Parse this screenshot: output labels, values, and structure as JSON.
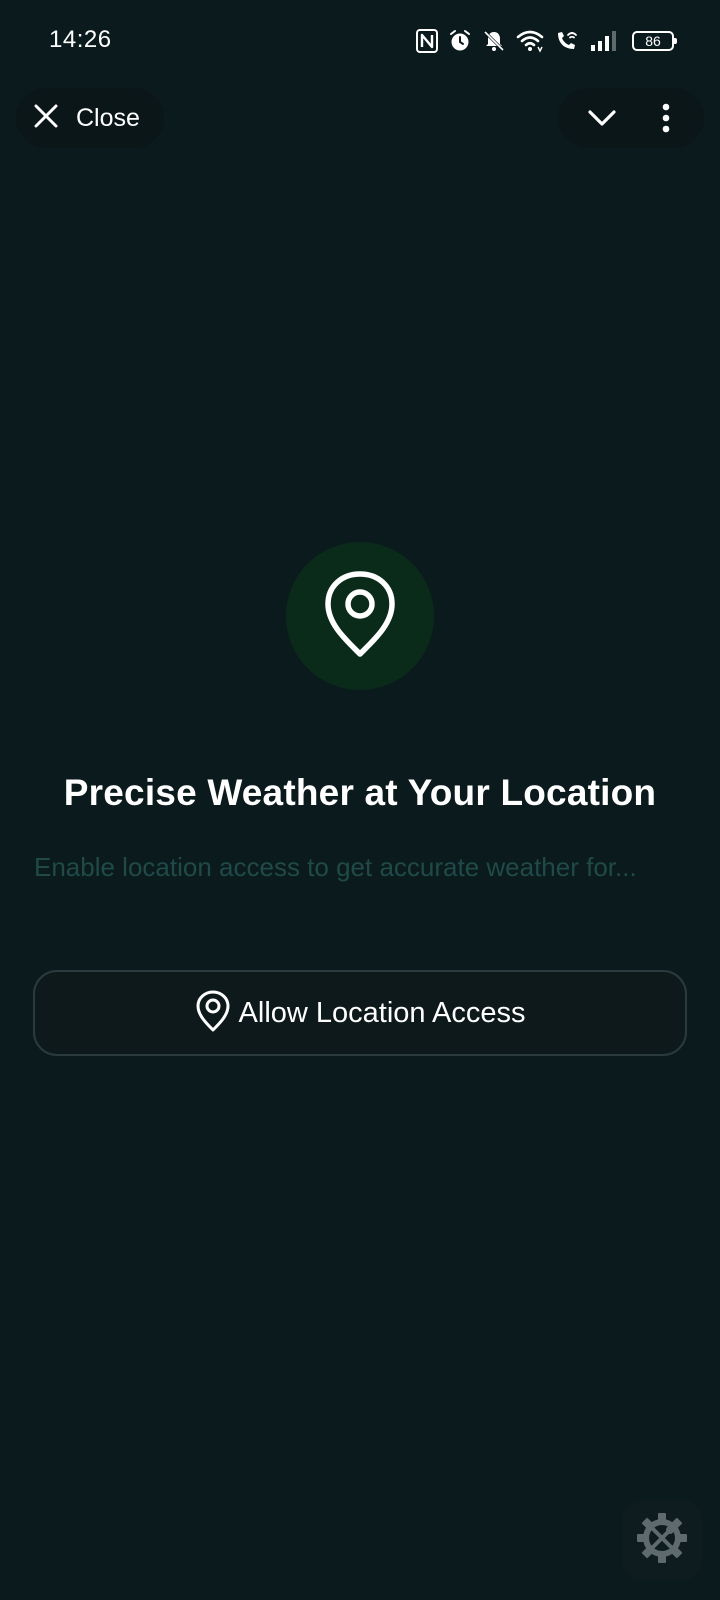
{
  "status_bar": {
    "time": "14:26",
    "battery": "86",
    "icons": [
      "nfc-icon",
      "alarm-icon",
      "bell-off-icon",
      "wifi-icon",
      "wifi-call-icon",
      "signal-icon",
      "battery-icon"
    ]
  },
  "top_bar": {
    "close_label": "Close",
    "close_icon": "close-icon",
    "collapse_icon": "chevron-down-icon",
    "menu_icon": "more-vertical-icon"
  },
  "hero": {
    "icon": "location-pin-icon",
    "headline": "Precise Weather at Your Location",
    "subtext": "Enable location access to get accurate weather for..."
  },
  "allow_button": {
    "icon": "location-pin-icon",
    "label": "Allow Location Access"
  },
  "floating_tool": {
    "icon": "settings-tools-icon"
  },
  "colors": {
    "background": "#0b1a1d",
    "pill_background": "#0a1618",
    "pin_circle": "#0a2b1a",
    "subtext": "#1f4a48",
    "button_border": "#2b3b3d"
  }
}
